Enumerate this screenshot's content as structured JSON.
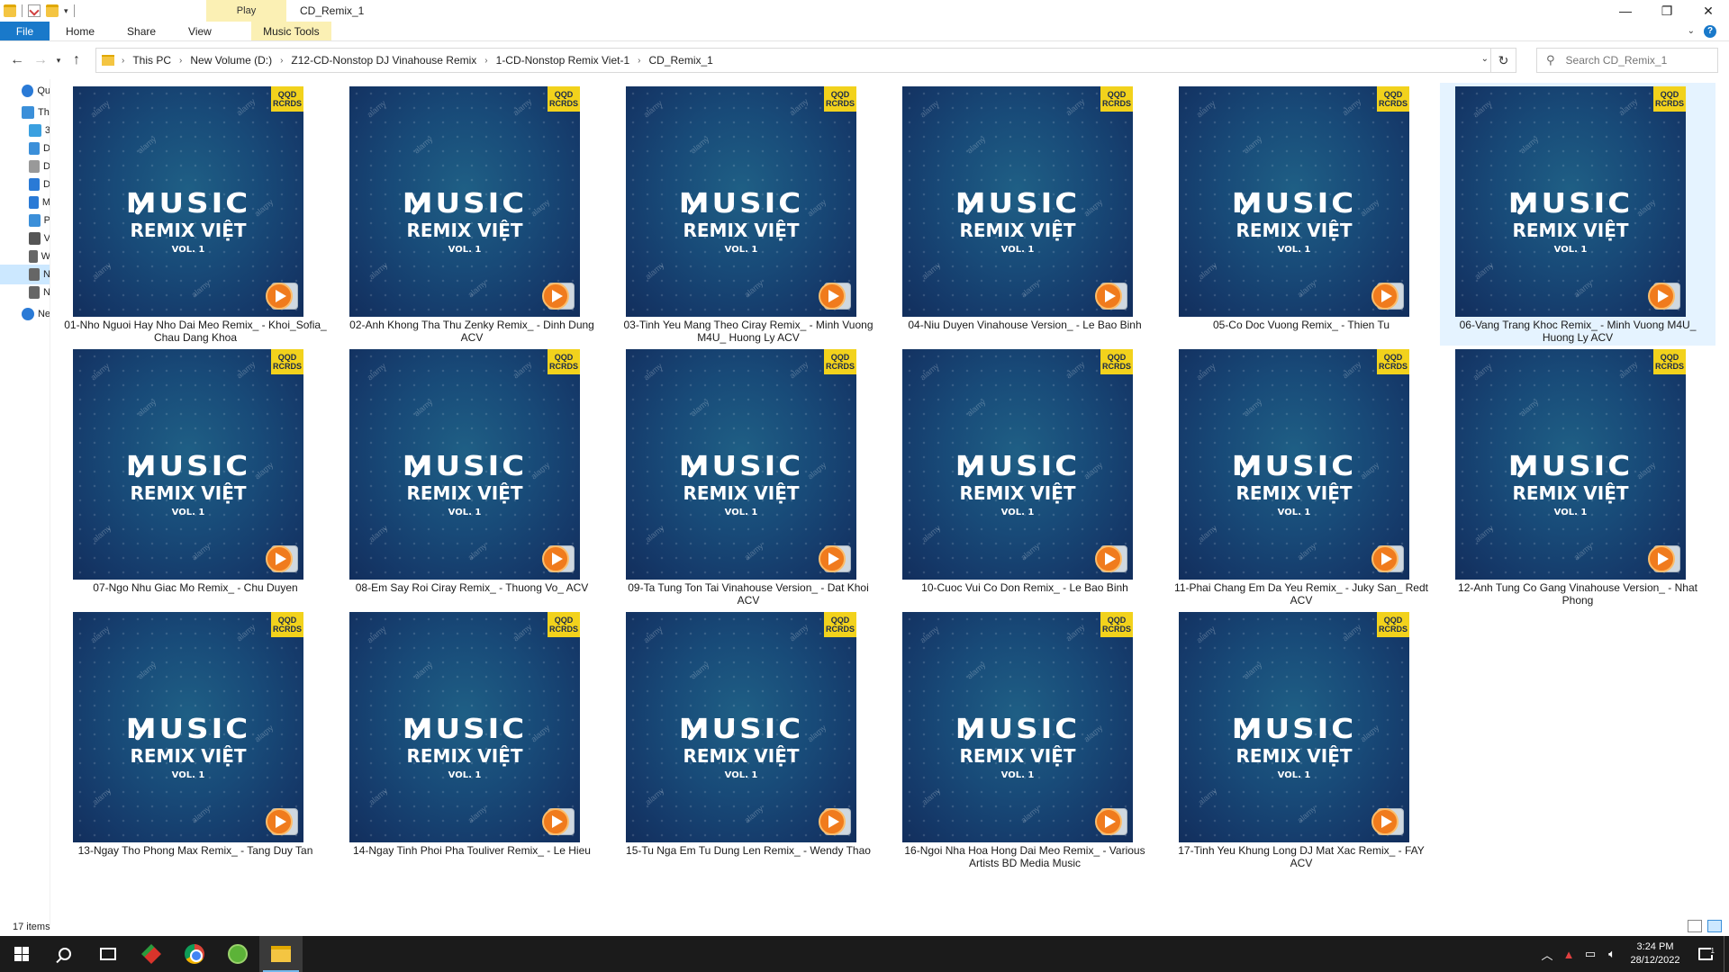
{
  "window": {
    "title": "CD_Remix_1",
    "context_tab_header": "Play",
    "controls": {
      "minimize": "—",
      "maximize": "❐",
      "close": "✕"
    }
  },
  "ribbon": {
    "tabs": [
      "File",
      "Home",
      "Share",
      "View",
      "Music Tools"
    ],
    "expand_glyph": "⌄",
    "help_glyph": "?"
  },
  "address": {
    "crumbs": [
      "This PC",
      "New Volume (D:)",
      "Z12-CD-Nonstop DJ Vinahouse Remix",
      "1-CD-Nonstop Remix Viet-1",
      "CD_Remix_1"
    ],
    "search_placeholder": "Search CD_Remix_1"
  },
  "nav_pane": {
    "items": [
      {
        "label": "Qu",
        "icon": "star-icon"
      },
      {
        "label": "Th",
        "icon": "pc-icon"
      },
      {
        "label": "3",
        "icon": "cube-icon"
      },
      {
        "label": "D",
        "icon": "desktop-icon"
      },
      {
        "label": "D",
        "icon": "document-icon"
      },
      {
        "label": "D",
        "icon": "download-icon"
      },
      {
        "label": "M",
        "icon": "music-icon"
      },
      {
        "label": "P",
        "icon": "pictures-icon"
      },
      {
        "label": "V",
        "icon": "video-icon"
      },
      {
        "label": "W",
        "icon": "drive-icon"
      },
      {
        "label": "N",
        "icon": "drive-icon"
      },
      {
        "label": "N",
        "icon": "drive-icon"
      },
      {
        "label": "Ne",
        "icon": "network-icon"
      }
    ]
  },
  "album_art": {
    "badge_line1": "QQD",
    "badge_line2": "RCRDS",
    "word_music": "MUSIC",
    "word_remix": "REMIX VIỆT",
    "word_vol": "VOL. 1",
    "watermark": "alamy"
  },
  "files": [
    {
      "name": "01-Nho Nguoi Hay Nho Dai Meo Remix_ - Khoi_Sofia_ Chau Dang Khoa"
    },
    {
      "name": "02-Anh Khong Tha Thu Zenky Remix_ - Dinh Dung ACV"
    },
    {
      "name": "03-Tinh Yeu Mang Theo Ciray Remix_ - Minh Vuong M4U_ Huong Ly ACV"
    },
    {
      "name": "04-Niu Duyen Vinahouse Version_ - Le Bao Binh"
    },
    {
      "name": "05-Co Doc Vuong Remix_ - Thien Tu"
    },
    {
      "name": "06-Vang Trang Khoc Remix_ - Minh Vuong M4U_ Huong Ly ACV"
    },
    {
      "name": "07-Ngo Nhu Giac Mo Remix_ - Chu Duyen"
    },
    {
      "name": "08-Em Say Roi Ciray Remix_ - Thuong Vo_ ACV"
    },
    {
      "name": "09-Ta Tung Ton Tai Vinahouse Version_ - Dat Khoi ACV"
    },
    {
      "name": "10-Cuoc Vui Co Don Remix_ - Le Bao Binh"
    },
    {
      "name": "11-Phai Chang Em Da Yeu Remix_ - Juky San_ Redt ACV"
    },
    {
      "name": "12-Anh Tung Co Gang Vinahouse Version_ - Nhat Phong"
    },
    {
      "name": "13-Ngay Tho Phong Max Remix_ - Tang Duy Tan"
    },
    {
      "name": "14-Ngay Tinh Phoi Pha Touliver Remix_ - Le Hieu"
    },
    {
      "name": "15-Tu Nga Em Tu Dung Len Remix_ - Wendy Thao"
    },
    {
      "name": "16-Ngoi Nha Hoa Hong Dai Meo Remix_ - Various Artists BD Media Music"
    },
    {
      "name": "17-Tinh Yeu Khung Long DJ Mat Xac Remix_ - FAY ACV"
    }
  ],
  "selected_index": 5,
  "status": {
    "item_count": "17 items"
  },
  "taskbar": {
    "time": "3:24 PM",
    "date": "28/12/2022",
    "notification_count": "1"
  },
  "colors": {
    "file_tab": "#1979ca",
    "context_tab": "#fbf0b4",
    "selection": "#cce8ff",
    "badge": "#f2d21c",
    "play_button": "#f07b1d"
  }
}
